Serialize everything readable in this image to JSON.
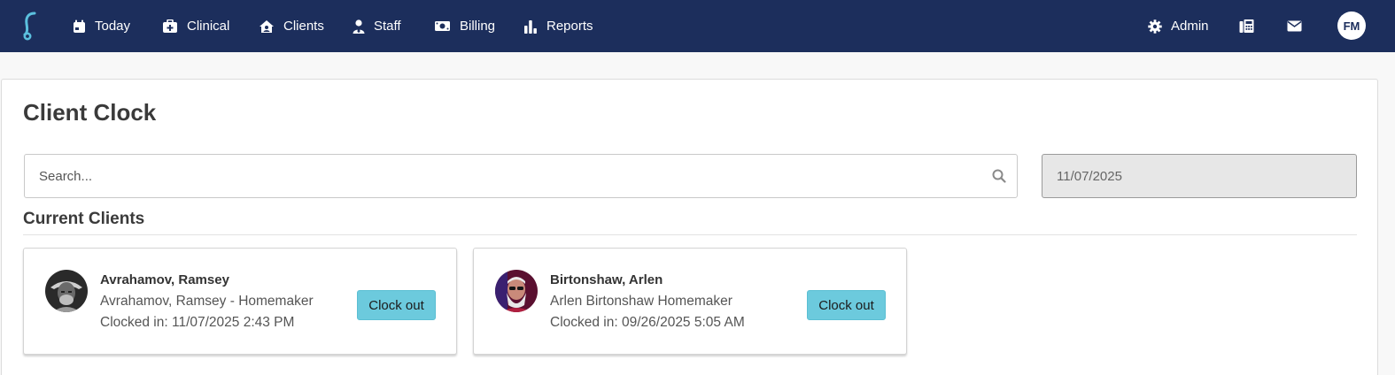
{
  "nav": {
    "items": [
      {
        "label": "Today",
        "icon": "calendar-icon"
      },
      {
        "label": "Clinical",
        "icon": "medical-kit-icon"
      },
      {
        "label": "Clients",
        "icon": "house-user-icon"
      },
      {
        "label": "Staff",
        "icon": "user-tie-icon"
      },
      {
        "label": "Billing",
        "icon": "money-bill-icon"
      },
      {
        "label": "Reports",
        "icon": "bar-chart-icon"
      }
    ],
    "admin_label": "Admin",
    "user_initials": "FM",
    "colors": {
      "bar": "#1c2e5c",
      "logo": "#5bc0de"
    }
  },
  "page": {
    "title": "Client Clock",
    "search_placeholder": "Search...",
    "date_value": "11/07/2025",
    "section_title": "Current Clients"
  },
  "clients": [
    {
      "name": "Avrahamov, Ramsey",
      "subtitle": "Avrahamov, Ramsey - Homemaker",
      "clocked_in": "Clocked in: 11/07/2025 2:43 PM",
      "button_label": "Clock out"
    },
    {
      "name": "Birtonshaw, Arlen",
      "subtitle": "Arlen Birtonshaw Homemaker",
      "clocked_in": "Clocked in: 09/26/2025 5:05 AM",
      "button_label": "Clock out"
    }
  ],
  "accent": "#6ccadd"
}
